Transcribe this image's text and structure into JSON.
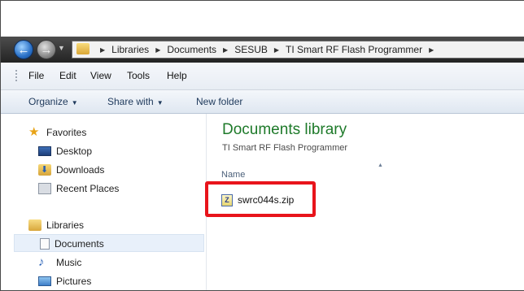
{
  "address_bar": {
    "breadcrumbs": [
      "Libraries",
      "Documents",
      "SESUB",
      "TI Smart RF Flash Programmer"
    ]
  },
  "menu": [
    "File",
    "Edit",
    "View",
    "Tools",
    "Help"
  ],
  "toolbar": {
    "organize": "Organize",
    "share_with": "Share with",
    "new_folder": "New folder"
  },
  "nav_pane": {
    "favorites": {
      "label": "Favorites",
      "items": [
        "Desktop",
        "Downloads",
        "Recent Places"
      ]
    },
    "libraries": {
      "label": "Libraries",
      "items": [
        "Documents",
        "Music",
        "Pictures"
      ],
      "selected": "Documents"
    }
  },
  "content": {
    "title": "Documents library",
    "subtitle": "TI Smart RF Flash Programmer",
    "column_name": "Name",
    "files": [
      {
        "name": "swrc044s.zip",
        "icon": "zip-icon"
      }
    ]
  },
  "highlight_color": "#e8141b",
  "accent_color": "#1e7a2a"
}
